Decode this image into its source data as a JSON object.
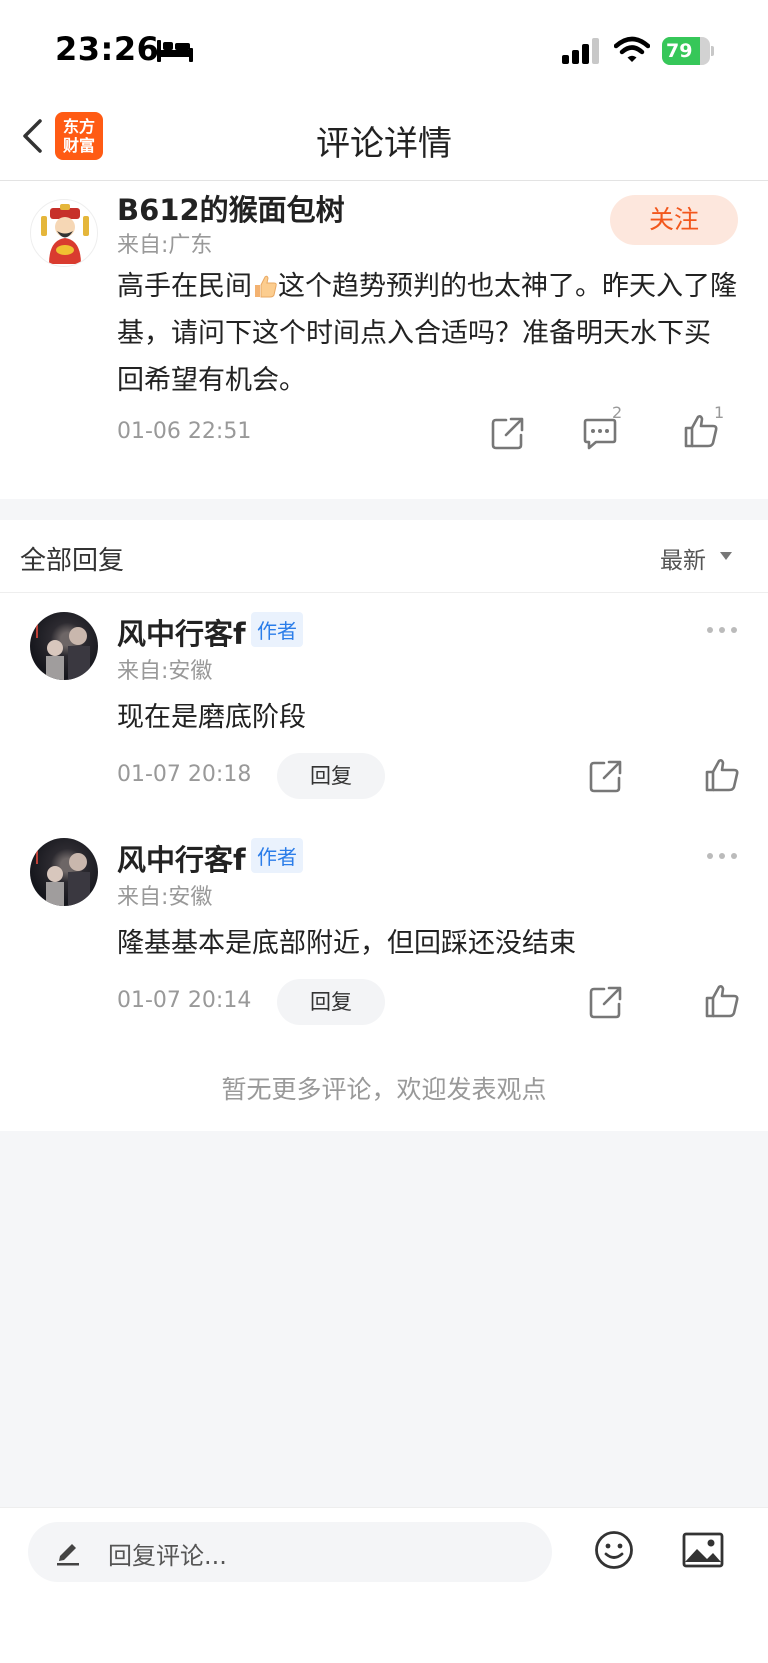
{
  "status_bar": {
    "time": "23:26",
    "battery_percent": "79",
    "battery_level": 0.79,
    "icons": [
      "bed-icon",
      "signal-icon",
      "wifi-icon",
      "battery-icon"
    ]
  },
  "nav": {
    "title": "评论详情",
    "app_logo_line1": "东方",
    "app_logo_line2": "财富"
  },
  "post": {
    "username": "B612的猴面包树",
    "location": "来自:广东",
    "follow_label": "关注",
    "text_part1": "高手在民间",
    "text_part2": "这个趋势预判的也太神了。昨天入了隆基，请问下这个时间点入合适吗？准备明天水下买回希望有机会。",
    "datetime": "01-06 22:51",
    "comment_count": "2",
    "like_count": "1"
  },
  "replies_header": {
    "title": "全部回复",
    "sort_label": "最新"
  },
  "replies": [
    {
      "username": "风中行客f",
      "tag": "作者",
      "location": "来自:安徽",
      "text": "现在是磨底阶段",
      "datetime": "01-07 20:18",
      "reply_label": "回复"
    },
    {
      "username": "风中行客f",
      "tag": "作者",
      "location": "来自:安徽",
      "text": "隆基基本是底部附近，但回踩还没结束",
      "datetime": "01-07 20:14",
      "reply_label": "回复"
    }
  ],
  "end_note": "暂无更多评论，欢迎发表观点",
  "bottom_bar": {
    "placeholder": "回复评论..."
  },
  "colors": {
    "brand_orange": "#ff5b14",
    "follow_text": "#f2571d",
    "author_tag": "#2b7de9",
    "battery_green": "#36c759"
  }
}
